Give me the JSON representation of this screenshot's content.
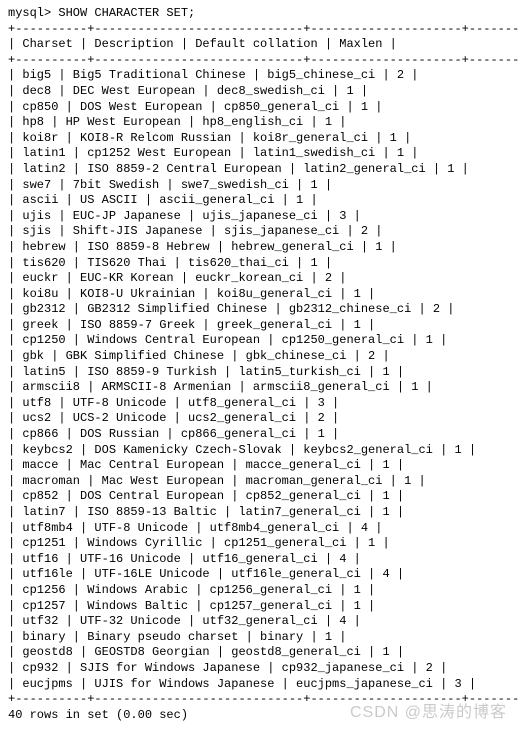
{
  "prompt_line": "mysql> SHOW CHARACTER SET;",
  "headers": {
    "c1": "Charset",
    "c2": "Description",
    "c3": "Default collation",
    "c4": "Maxlen"
  },
  "rows": [
    {
      "c1": "big5",
      "c2": "Big5 Traditional Chinese",
      "c3": "big5_chinese_ci",
      "c4": "2"
    },
    {
      "c1": "dec8",
      "c2": "DEC West European",
      "c3": "dec8_swedish_ci",
      "c4": "1"
    },
    {
      "c1": "cp850",
      "c2": "DOS West European",
      "c3": "cp850_general_ci",
      "c4": "1"
    },
    {
      "c1": "hp8",
      "c2": "HP West European",
      "c3": "hp8_english_ci",
      "c4": "1"
    },
    {
      "c1": "koi8r",
      "c2": "KOI8-R Relcom Russian",
      "c3": "koi8r_general_ci",
      "c4": "1"
    },
    {
      "c1": "latin1",
      "c2": "cp1252 West European",
      "c3": "latin1_swedish_ci",
      "c4": "1"
    },
    {
      "c1": "latin2",
      "c2": "ISO 8859-2 Central European",
      "c3": "latin2_general_ci",
      "c4": "1"
    },
    {
      "c1": "swe7",
      "c2": "7bit Swedish",
      "c3": "swe7_swedish_ci",
      "c4": "1"
    },
    {
      "c1": "ascii",
      "c2": "US ASCII",
      "c3": "ascii_general_ci",
      "c4": "1"
    },
    {
      "c1": "ujis",
      "c2": "EUC-JP Japanese",
      "c3": "ujis_japanese_ci",
      "c4": "3"
    },
    {
      "c1": "sjis",
      "c2": "Shift-JIS Japanese",
      "c3": "sjis_japanese_ci",
      "c4": "2"
    },
    {
      "c1": "hebrew",
      "c2": "ISO 8859-8 Hebrew",
      "c3": "hebrew_general_ci",
      "c4": "1"
    },
    {
      "c1": "tis620",
      "c2": "TIS620 Thai",
      "c3": "tis620_thai_ci",
      "c4": "1"
    },
    {
      "c1": "euckr",
      "c2": "EUC-KR Korean",
      "c3": "euckr_korean_ci",
      "c4": "2"
    },
    {
      "c1": "koi8u",
      "c2": "KOI8-U Ukrainian",
      "c3": "koi8u_general_ci",
      "c4": "1"
    },
    {
      "c1": "gb2312",
      "c2": "GB2312 Simplified Chinese",
      "c3": "gb2312_chinese_ci",
      "c4": "2"
    },
    {
      "c1": "greek",
      "c2": "ISO 8859-7 Greek",
      "c3": "greek_general_ci",
      "c4": "1"
    },
    {
      "c1": "cp1250",
      "c2": "Windows Central European",
      "c3": "cp1250_general_ci",
      "c4": "1"
    },
    {
      "c1": "gbk",
      "c2": "GBK Simplified Chinese",
      "c3": "gbk_chinese_ci",
      "c4": "2"
    },
    {
      "c1": "latin5",
      "c2": "ISO 8859-9 Turkish",
      "c3": "latin5_turkish_ci",
      "c4": "1"
    },
    {
      "c1": "armscii8",
      "c2": "ARMSCII-8 Armenian",
      "c3": "armscii8_general_ci",
      "c4": "1"
    },
    {
      "c1": "utf8",
      "c2": "UTF-8 Unicode",
      "c3": "utf8_general_ci",
      "c4": "3"
    },
    {
      "c1": "ucs2",
      "c2": "UCS-2 Unicode",
      "c3": "ucs2_general_ci",
      "c4": "2"
    },
    {
      "c1": "cp866",
      "c2": "DOS Russian",
      "c3": "cp866_general_ci",
      "c4": "1"
    },
    {
      "c1": "keybcs2",
      "c2": "DOS Kamenicky Czech-Slovak",
      "c3": "keybcs2_general_ci",
      "c4": "1"
    },
    {
      "c1": "macce",
      "c2": "Mac Central European",
      "c3": "macce_general_ci",
      "c4": "1"
    },
    {
      "c1": "macroman",
      "c2": "Mac West European",
      "c3": "macroman_general_ci",
      "c4": "1"
    },
    {
      "c1": "cp852",
      "c2": "DOS Central European",
      "c3": "cp852_general_ci",
      "c4": "1"
    },
    {
      "c1": "latin7",
      "c2": "ISO 8859-13 Baltic",
      "c3": "latin7_general_ci",
      "c4": "1"
    },
    {
      "c1": "utf8mb4",
      "c2": "UTF-8 Unicode",
      "c3": "utf8mb4_general_ci",
      "c4": "4"
    },
    {
      "c1": "cp1251",
      "c2": "Windows Cyrillic",
      "c3": "cp1251_general_ci",
      "c4": "1"
    },
    {
      "c1": "utf16",
      "c2": "UTF-16 Unicode",
      "c3": "utf16_general_ci",
      "c4": "4"
    },
    {
      "c1": "utf16le",
      "c2": "UTF-16LE Unicode",
      "c3": "utf16le_general_ci",
      "c4": "4"
    },
    {
      "c1": "cp1256",
      "c2": "Windows Arabic",
      "c3": "cp1256_general_ci",
      "c4": "1"
    },
    {
      "c1": "cp1257",
      "c2": "Windows Baltic",
      "c3": "cp1257_general_ci",
      "c4": "1"
    },
    {
      "c1": "utf32",
      "c2": "UTF-32 Unicode",
      "c3": "utf32_general_ci",
      "c4": "4"
    },
    {
      "c1": "binary",
      "c2": "Binary pseudo charset",
      "c3": "binary",
      "c4": "1"
    },
    {
      "c1": "geostd8",
      "c2": "GEOSTD8 Georgian",
      "c3": "geostd8_general_ci",
      "c4": "1"
    },
    {
      "c1": "cp932",
      "c2": "SJIS for Windows Japanese",
      "c3": "cp932_japanese_ci",
      "c4": "2"
    },
    {
      "c1": "eucjpms",
      "c2": "UJIS for Windows Japanese",
      "c3": "eucjpms_japanese_ci",
      "c4": "3"
    }
  ],
  "footer_line": "40 rows in set (0.00 sec)",
  "watermark": "CSDN @思涛的博客",
  "col_widths": {
    "c1": 10,
    "c2": 29,
    "c3": 21,
    "c4": 8
  }
}
